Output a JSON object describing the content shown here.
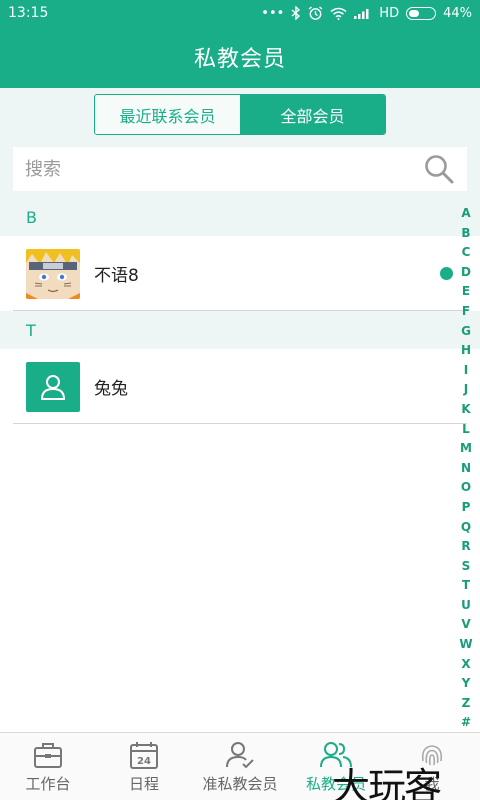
{
  "status": {
    "time": "13:15",
    "network": "HD",
    "battery_percent": "44%",
    "battery_level": 0.44
  },
  "header": {
    "title": "私教会员"
  },
  "toggle": {
    "recent_label": "最近联系会员",
    "all_label": "全部会员"
  },
  "search": {
    "placeholder": "搜索"
  },
  "sections": [
    {
      "letter": "B",
      "members": [
        {
          "name": "不语8",
          "online": true
        }
      ]
    },
    {
      "letter": "T",
      "members": [
        {
          "name": "兔兔",
          "online": false
        }
      ]
    }
  ],
  "alphabet": [
    "A",
    "B",
    "C",
    "D",
    "E",
    "F",
    "G",
    "H",
    "I",
    "J",
    "K",
    "L",
    "M",
    "N",
    "O",
    "P",
    "Q",
    "R",
    "S",
    "T",
    "U",
    "V",
    "W",
    "X",
    "Y",
    "Z",
    "#"
  ],
  "tabs": [
    {
      "label": "工作台",
      "icon": "briefcase-icon",
      "active": false
    },
    {
      "label": "日程",
      "icon": "calendar-icon",
      "active": false,
      "badge": "24"
    },
    {
      "label": "准私教会员",
      "icon": "user-check-icon",
      "active": false
    },
    {
      "label": "私教会员",
      "icon": "users-icon",
      "active": true
    },
    {
      "label": "我",
      "icon": "fingerprint-icon",
      "active": false
    }
  ],
  "watermark": "大玩客",
  "colors": {
    "primary": "#1aae88",
    "light_bg": "#eef6f5"
  }
}
